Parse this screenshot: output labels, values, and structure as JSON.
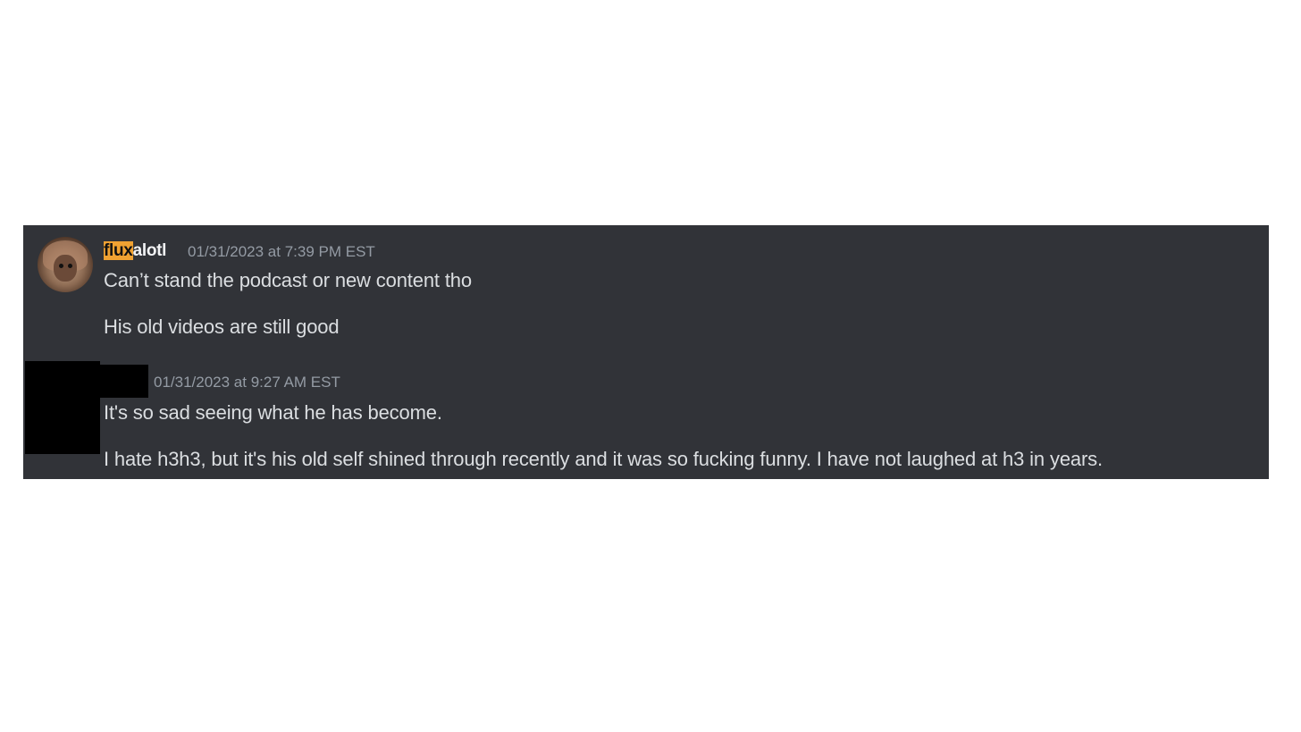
{
  "messages": [
    {
      "author": {
        "name_highlight": "flux",
        "name_rest": "alotl"
      },
      "timestamp": "01/31/2023 at 7:39 PM EST",
      "lines": [
        "Can’t stand the podcast or new content tho",
        "His old videos are still good"
      ]
    },
    {
      "author": {
        "redacted": true
      },
      "timestamp": "01/31/2023 at 9:27 AM EST",
      "lines": [
        "It's so sad seeing what he has become.",
        "I hate h3h3, but it's his old self shined through recently and it was so fucking funny. I have not laughed at h3 in years."
      ]
    }
  ],
  "colors": {
    "panel_bg": "#313338",
    "username_highlight": "#f0a232",
    "text": "#dbdee1",
    "timestamp": "#949ba4",
    "redaction": "#000000"
  }
}
